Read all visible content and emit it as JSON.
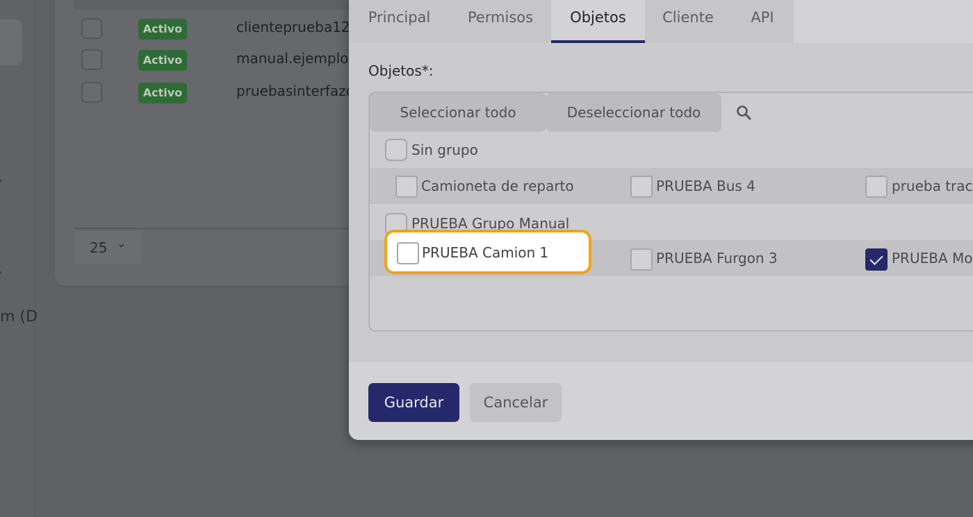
{
  "background": {
    "nav_partial_text": "m (D",
    "users": [
      {
        "status": "Activo",
        "username": "clienteprueba12"
      },
      {
        "status": "Activo",
        "username": "manual.ejemplo"
      },
      {
        "status": "Activo",
        "username": "pruebasinterfazo"
      }
    ],
    "page_size": "25"
  },
  "modal": {
    "tabs": [
      {
        "label": "Principal",
        "active": false
      },
      {
        "label": "Permisos",
        "active": false
      },
      {
        "label": "Objetos",
        "active": true
      },
      {
        "label": "Cliente",
        "active": false
      },
      {
        "label": "API",
        "active": false
      }
    ],
    "objects_label": "Objetos*:",
    "toolbar": {
      "select_all": "Seleccionar todo",
      "deselect_all": "Deseleccionar todo",
      "search_icon": "search-icon"
    },
    "groups": [
      {
        "name": "Sin grupo",
        "items": [
          {
            "label": "Camioneta de reparto",
            "checked": false
          },
          {
            "label": "PRUEBA Bus 4",
            "checked": false
          },
          {
            "label": "prueba track",
            "checked": false
          }
        ]
      },
      {
        "name": "PRUEBA Grupo Manual",
        "items": [
          {
            "label": "PRUEBA Camion 1",
            "checked": false,
            "highlighted": true
          },
          {
            "label": "PRUEBA Furgon 3",
            "checked": false
          },
          {
            "label": "PRUEBA Mot",
            "checked": true
          }
        ]
      }
    ],
    "save_label": "Guardar",
    "cancel_label": "Cancelar"
  },
  "colors": {
    "accent": "#25286a",
    "highlight": "#f0a21a",
    "badge_active": "#2f6b37"
  }
}
